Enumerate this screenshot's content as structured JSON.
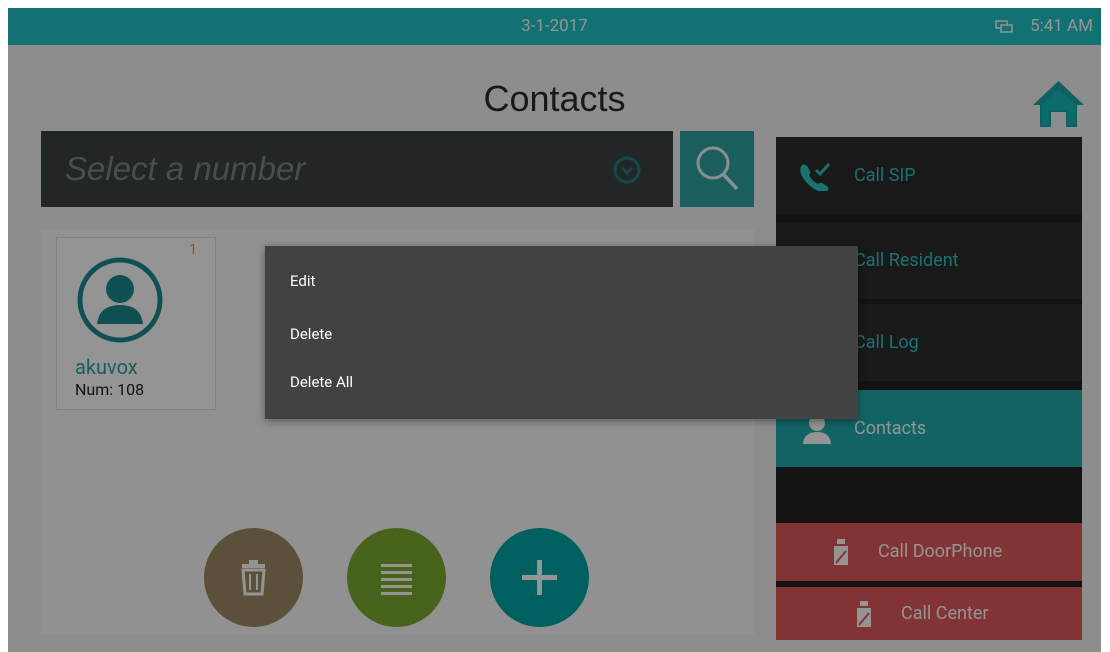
{
  "status_bar": {
    "date": "3-1-2017",
    "time": "5:41 AM",
    "network_icon": "network-icon"
  },
  "header": {
    "title": "Contacts",
    "home_icon": "home-icon"
  },
  "search": {
    "placeholder": "Select a number",
    "dropdown_icon": "chevron-circle-down-icon",
    "search_icon": "search-icon"
  },
  "contacts": [
    {
      "name": "akuvox",
      "number": "Num: 108",
      "count": "1",
      "avatar_icon": "person-avatar-icon"
    }
  ],
  "actions": {
    "delete_icon": "trash-icon",
    "list_icon": "list-icon",
    "add_icon": "plus-icon"
  },
  "nav": {
    "items": [
      {
        "label": "Call SIP",
        "icon": "phone-call-icon"
      },
      {
        "label": "Call Resident",
        "icon": "resident-icon"
      },
      {
        "label": "Call Log",
        "icon": "log-icon"
      },
      {
        "label": "Contacts",
        "icon": "contact-icon",
        "active": true
      },
      {
        "label": "Call DoorPhone",
        "icon": "doorphone-icon"
      },
      {
        "label": "Call Center",
        "icon": "center-icon"
      }
    ]
  },
  "context_menu": {
    "items": [
      "Edit",
      "Delete",
      "Delete All"
    ]
  },
  "colors": {
    "accent": "#1fc3c6",
    "teal": "#00a6a6",
    "red": "#e15a5a",
    "menu_bg": "#424242"
  }
}
